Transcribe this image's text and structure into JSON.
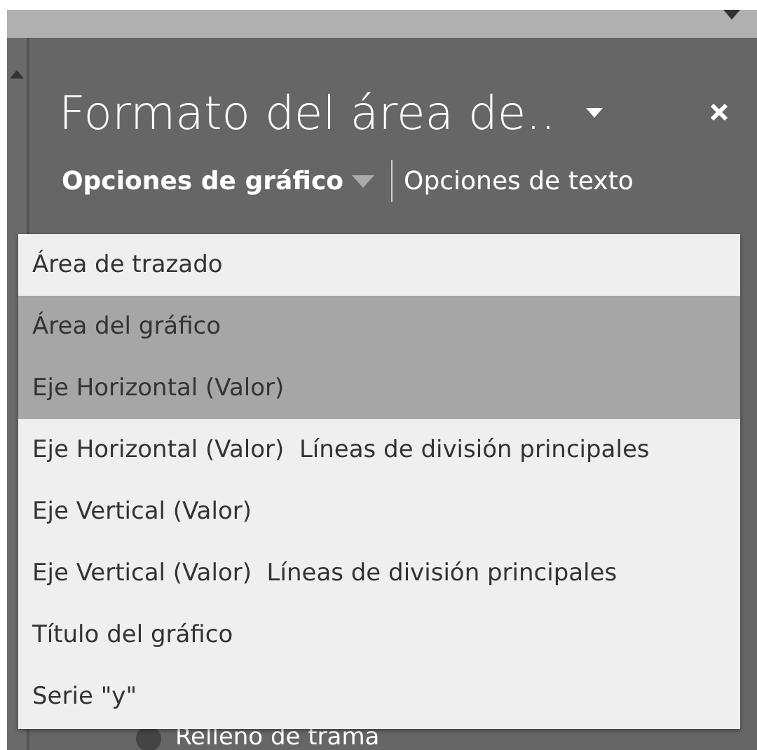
{
  "pane": {
    "title": "Formato del área de..",
    "tabs": [
      {
        "label": "Opciones de gráfico",
        "selected": true
      },
      {
        "label": "Opciones de texto",
        "selected": false
      }
    ]
  },
  "dropdown": {
    "items": [
      {
        "label": "Área de trazado",
        "selected": false
      },
      {
        "label": "Área del gráfico",
        "selected": true
      },
      {
        "label": "Eje Horizontal (Valor)",
        "selected": true
      },
      {
        "label": "Eje Horizontal (Valor)  Líneas de división principales",
        "selected": false
      },
      {
        "label": "Eje Vertical (Valor)",
        "selected": false
      },
      {
        "label": "Eje Vertical (Valor)  Líneas de división principales",
        "selected": false
      },
      {
        "label": "Título del gráfico",
        "selected": false
      },
      {
        "label": "Serie \"y\"",
        "selected": false
      }
    ]
  },
  "behind": {
    "option": "Relleno de trama",
    "selected": false
  }
}
